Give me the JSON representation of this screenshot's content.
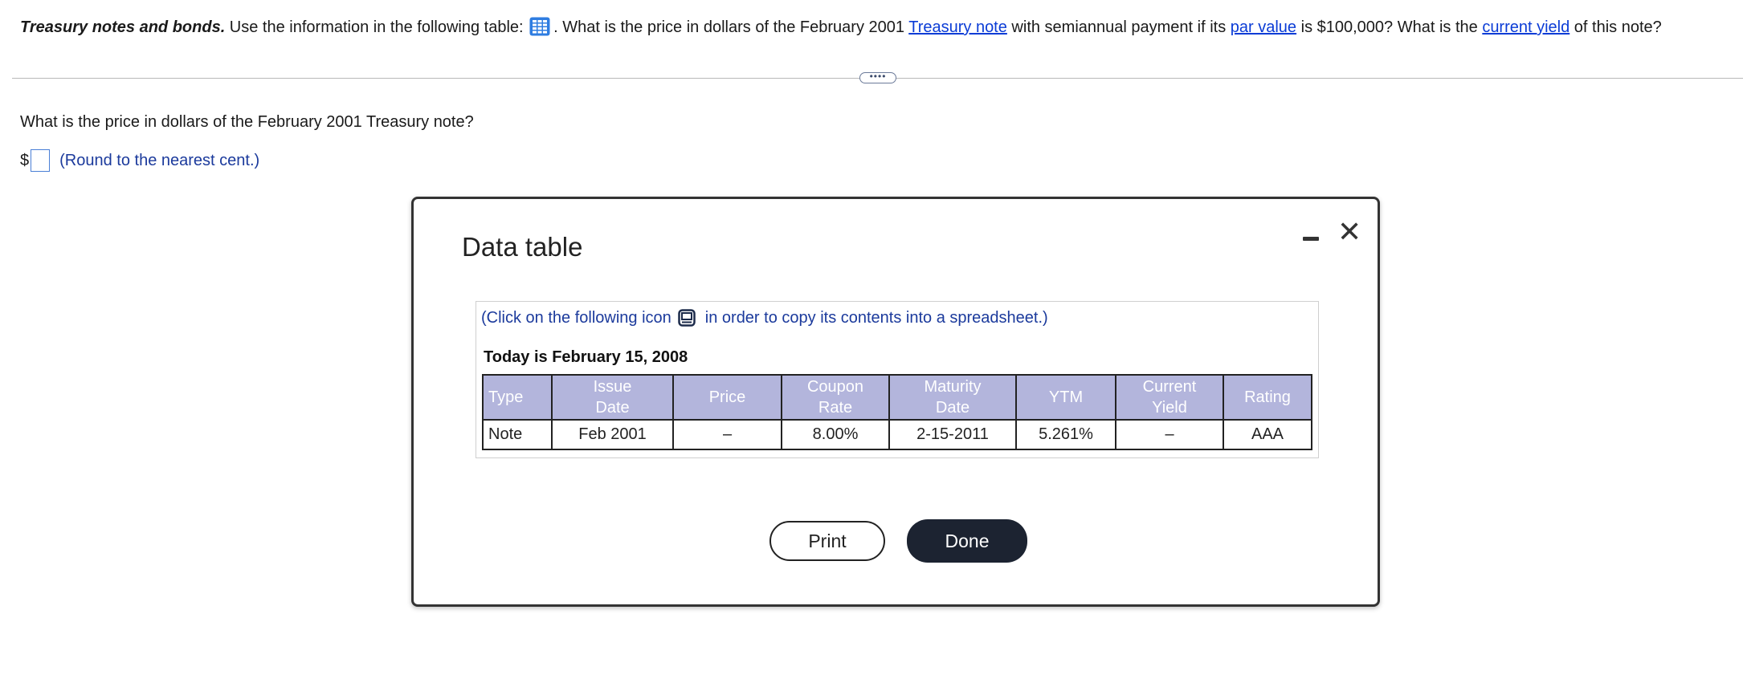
{
  "question": {
    "lead": "Treasury notes and bonds.",
    "part1": " Use the information in the following table: ",
    "part2": ". What is the price in dollars of the February 2001 ",
    "link1": "Treasury note",
    "part3": " with semiannual payment if its ",
    "link2": "par value",
    "part4": " is $100,000? What is the ",
    "link3": "current yield",
    "part5": " of this note?"
  },
  "more_button_label": "••••",
  "sub_question": "What is the price in dollars of the February 2001 Treasury note?",
  "answer": {
    "currency": "$",
    "value": "",
    "hint": "(Round to the nearest cent.)"
  },
  "modal": {
    "title": "Data table",
    "close_glyph": "✕",
    "copy_note_before": "(Click on the following icon",
    "copy_note_after": "in order to copy its contents into a spreadsheet.)",
    "today": "Today is February 15, 2008",
    "table": {
      "headers": [
        "Type",
        "Issue Date",
        "Price",
        "Coupon Rate",
        "Maturity Date",
        "YTM",
        "Current Yield",
        "Rating"
      ],
      "rows": [
        [
          "Note",
          "Feb 2001",
          "–",
          "8.00%",
          "2-15-2011",
          "5.261%",
          "–",
          "AAA"
        ]
      ]
    },
    "print_label": "Print",
    "done_label": "Done"
  },
  "icons": {
    "table_icon": "table-grid-icon",
    "copy_icon": "spreadsheet-copy-icon",
    "minimize_icon": "minimize-icon",
    "close_icon": "close-icon"
  },
  "colors": {
    "link": "#0b3cd6",
    "header_fill": "#b3b5dc",
    "hint": "#1b3a9c",
    "done_button": "#1c2331",
    "table_icon_blue": "#2f7de1"
  }
}
